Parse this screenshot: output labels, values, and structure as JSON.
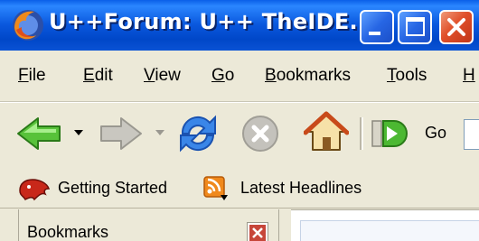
{
  "window": {
    "title": "U++Forum: U++ TheIDE...",
    "buttons": {
      "minimize": "minimize-icon",
      "maximize": "maximize-icon",
      "close": "close-icon"
    }
  },
  "menu": [
    {
      "accel": "F",
      "rest": "ile"
    },
    {
      "accel": "E",
      "rest": "dit"
    },
    {
      "accel": "V",
      "rest": "iew"
    },
    {
      "accel": "G",
      "rest": "o"
    },
    {
      "accel": "B",
      "rest": "ookmarks"
    },
    {
      "accel": "T",
      "rest": "ools"
    },
    {
      "accel": "H",
      "rest": ""
    }
  ],
  "toolbar": {
    "go_label": "Go",
    "icons": [
      "back-arrow-icon",
      "dropdown-icon",
      "forward-arrow-icon",
      "dropdown-icon",
      "reload-icon",
      "stop-icon",
      "home-icon",
      "go-icon"
    ]
  },
  "bookmarks_bar": [
    {
      "label": "Getting Started",
      "icon": "getting-started-icon"
    },
    {
      "label": "Latest Headlines",
      "icon": "rss-feed-icon"
    }
  ],
  "sidebar": {
    "title": "Bookmarks",
    "close_icon": "close-icon"
  },
  "colors": {
    "titlebar": "#0a58de",
    "chrome": "#ece9d8",
    "close_button": "#e0502a"
  }
}
